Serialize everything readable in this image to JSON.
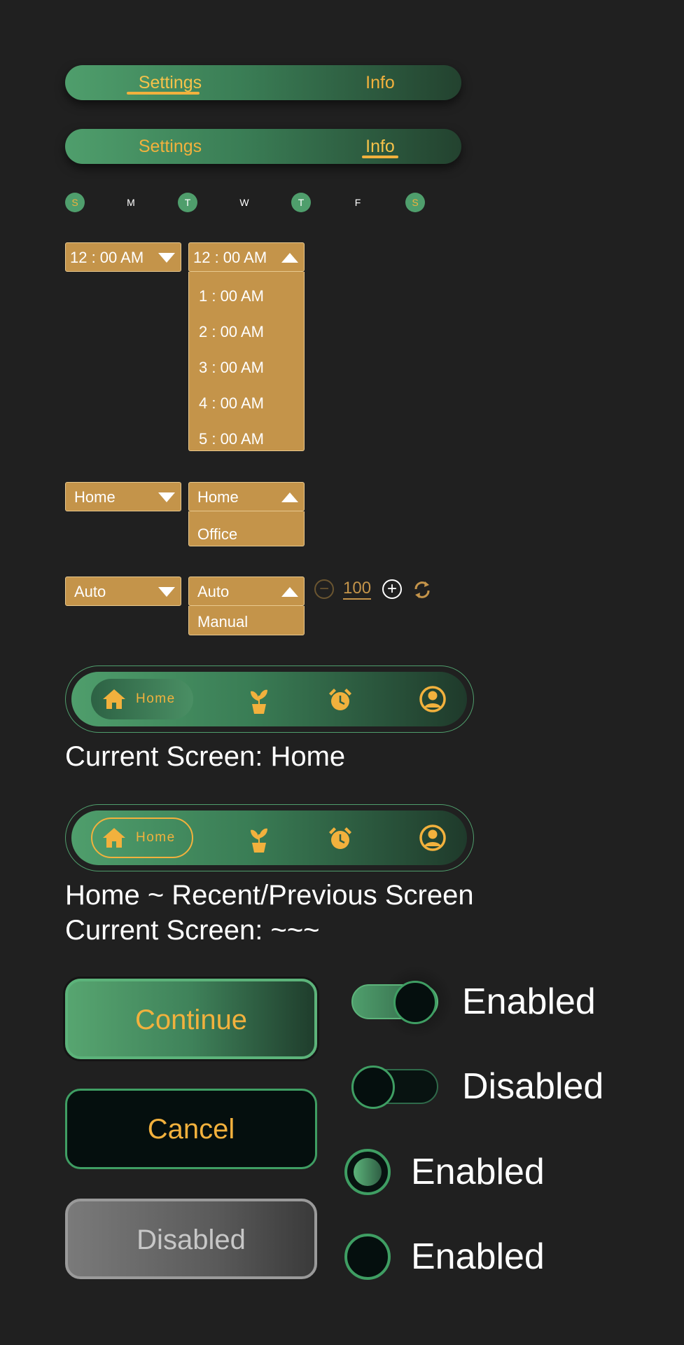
{
  "tabs_primary": {
    "tabs": [
      {
        "label": "Settings"
      },
      {
        "label": "Info"
      }
    ],
    "active": "Settings"
  },
  "tabs_secondary": {
    "tabs": [
      {
        "label": "Settings"
      },
      {
        "label": "Info"
      }
    ],
    "active": "Info"
  },
  "days": [
    {
      "label": "S",
      "selected": true
    },
    {
      "label": "M",
      "selected": false
    },
    {
      "label": "T",
      "selected": true
    },
    {
      "label": "W",
      "selected": false
    },
    {
      "label": "T",
      "selected": true
    },
    {
      "label": "F",
      "selected": false
    },
    {
      "label": "S",
      "selected": true
    }
  ],
  "time_dropdown": {
    "value": "12 : 00 AM",
    "options": [
      "1 : 00 AM",
      "2 : 00 AM",
      "3 : 00 AM",
      "4 : 00 AM",
      "5 : 00 AM"
    ]
  },
  "location_dropdown": {
    "value": "Home",
    "options": [
      "Office"
    ]
  },
  "mode_dropdown": {
    "value": "Auto",
    "options": [
      "Manual"
    ]
  },
  "stepper": {
    "value": "100"
  },
  "nav": {
    "home_label": "Home",
    "items": [
      "home-icon",
      "plant-icon",
      "alarm-clock-icon",
      "user-icon"
    ]
  },
  "captions": {
    "current_screen_home": "Current Screen: Home",
    "recent_previous": "Home ~ Recent/Previous Screen",
    "current_screen_other": "Current Screen: ~~~"
  },
  "buttons": {
    "continue": "Continue",
    "cancel": "Cancel",
    "disabled": "Disabled"
  },
  "toggles": [
    {
      "label": "Enabled",
      "on": true
    },
    {
      "label": "Disabled",
      "on": false
    }
  ],
  "radios": [
    {
      "label": "Enabled",
      "selected": true
    },
    {
      "label": "Enabled",
      "selected": false
    }
  ],
  "colors": {
    "background": "#202020",
    "accent_green": "#4f9e6c",
    "accent_gold": "#f2b13d",
    "dropdown_gold": "#c4944a"
  }
}
